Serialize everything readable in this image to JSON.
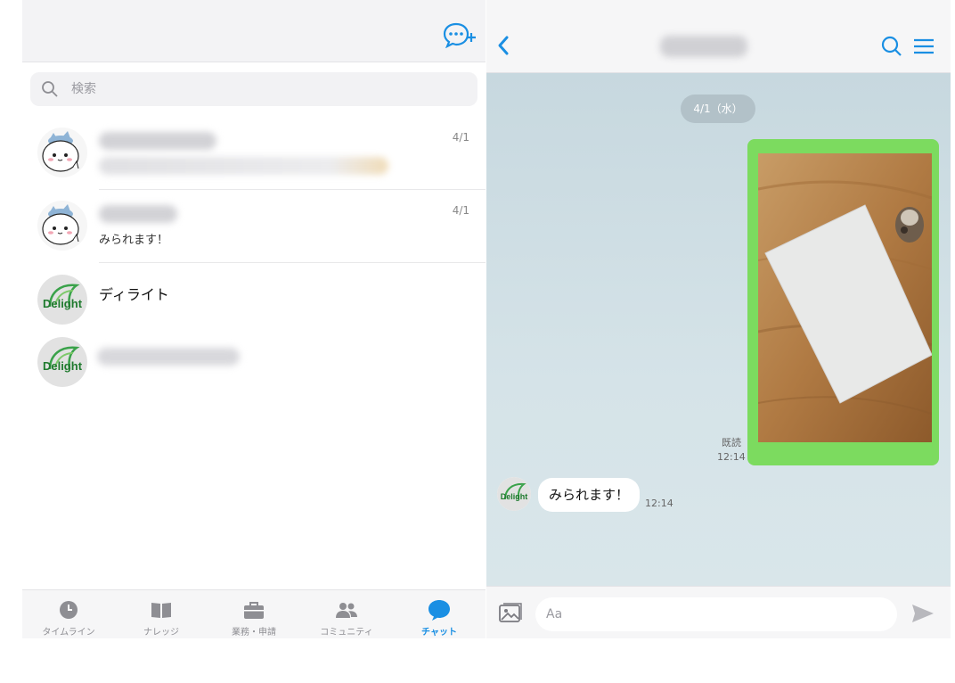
{
  "left_pane": {
    "search_placeholder": "検索",
    "chats": [
      {
        "preview": "",
        "date": "4/1",
        "avatar": "cat-avatar"
      },
      {
        "preview": "みられます！",
        "date": "4/1",
        "avatar": "cat-avatar"
      },
      {
        "name": "ディライト",
        "avatar": "delight-logo"
      },
      {
        "avatar": "delight-logo"
      }
    ],
    "tabs": [
      {
        "label": "タイムライン",
        "icon": "clock-icon"
      },
      {
        "label": "ナレッジ",
        "icon": "book-icon"
      },
      {
        "label": "業務・申請",
        "icon": "briefcase-icon"
      },
      {
        "label": "コミュニティ",
        "icon": "people-icon"
      },
      {
        "label": "チャット",
        "icon": "chat-icon",
        "active": true
      }
    ]
  },
  "chat": {
    "date_separator": "4/1（水）",
    "read_label": "既読",
    "sent_time": "12:14",
    "received_message": "みられます！",
    "received_time": "12:14",
    "input_placeholder": "Aa"
  },
  "logo_text": "Delight",
  "colors": {
    "accent": "#1a8fe3",
    "sent_bubble": "#7cdb5f",
    "chat_background": "#c9d9e0"
  }
}
